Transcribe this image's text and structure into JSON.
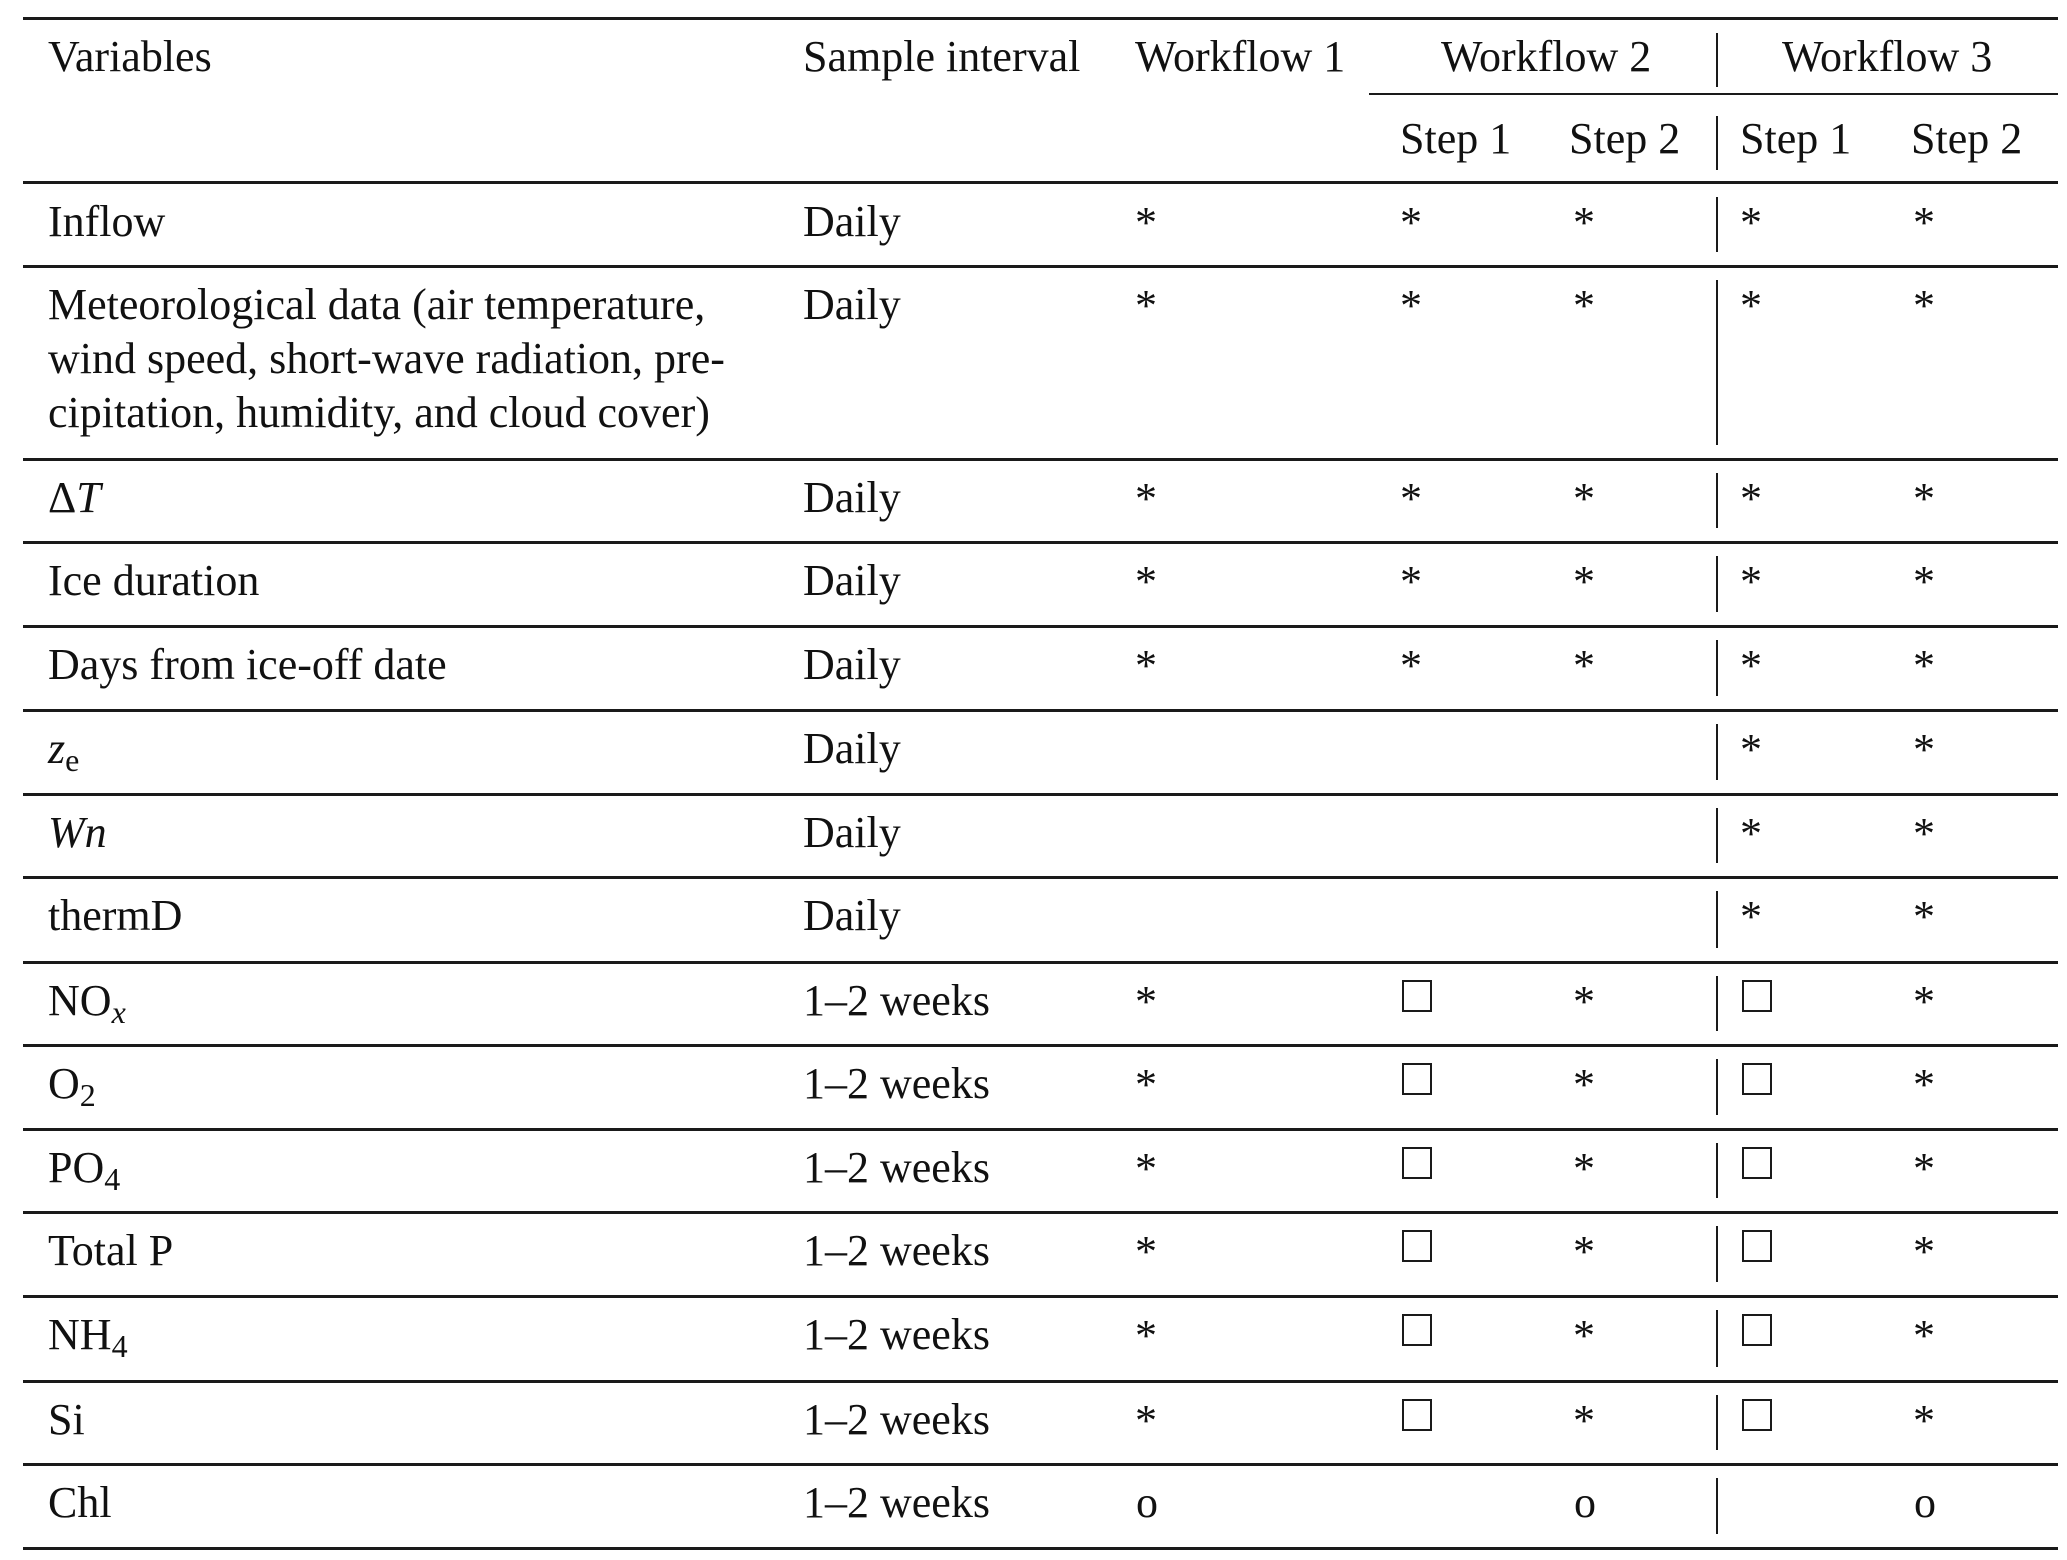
{
  "header": {
    "variables": "Variables",
    "sample_interval": "Sample interval",
    "workflow1": "Workflow 1",
    "workflow2": "Workflow 2",
    "workflow3": "Workflow 3",
    "wf2_step1": "Step 1",
    "wf2_step2": "Step 2",
    "wf3_step1": "Step 1",
    "wf3_step2": "Step 2"
  },
  "legend_symbols": {
    "star": "*",
    "box": "□",
    "circle": "o"
  },
  "rows": [
    {
      "variable": "Inflow",
      "interval": "Daily",
      "wf1": "*",
      "wf2_s1": "*",
      "wf2_s2": "*",
      "wf3_s1": "*",
      "wf3_s2": "*"
    },
    {
      "variable": "Meteorological data (air temperature, wind speed, short-wave radiation, pre-cipitation, humidity, and cloud cover)",
      "line1": "Meteorological data (air temperature,",
      "line2": "wind speed, short-wave radiation, pre-",
      "line3": "cipitation, humidity, and cloud cover)",
      "interval": "Daily",
      "wf1": "*",
      "wf2_s1": "*",
      "wf2_s2": "*",
      "wf3_s1": "*",
      "wf3_s2": "*"
    },
    {
      "variable": "ΔT",
      "var_main": "Δ",
      "var_italic": "T",
      "interval": "Daily",
      "wf1": "*",
      "wf2_s1": "*",
      "wf2_s2": "*",
      "wf3_s1": "*",
      "wf3_s2": "*"
    },
    {
      "variable": "Ice duration",
      "interval": "Daily",
      "wf1": "*",
      "wf2_s1": "*",
      "wf2_s2": "*",
      "wf3_s1": "*",
      "wf3_s2": "*"
    },
    {
      "variable": "Days from ice-off date",
      "interval": "Daily",
      "wf1": "*",
      "wf2_s1": "*",
      "wf2_s2": "*",
      "wf3_s1": "*",
      "wf3_s2": "*"
    },
    {
      "variable": "ze",
      "var_main": "z",
      "var_sub": "e",
      "interval": "Daily",
      "wf1": "",
      "wf2_s1": "",
      "wf2_s2": "",
      "wf3_s1": "*",
      "wf3_s2": "*"
    },
    {
      "variable": "Wn",
      "interval": "Daily",
      "wf1": "",
      "wf2_s1": "",
      "wf2_s2": "",
      "wf3_s1": "*",
      "wf3_s2": "*"
    },
    {
      "variable": "thermD",
      "interval": "Daily",
      "wf1": "",
      "wf2_s1": "",
      "wf2_s2": "",
      "wf3_s1": "*",
      "wf3_s2": "*"
    },
    {
      "variable": "NOx",
      "var_main": "NO",
      "var_sub": "x",
      "interval": "1–2 weeks",
      "wf1": "*",
      "wf2_s1": "□",
      "wf2_s2": "*",
      "wf3_s1": "□",
      "wf3_s2": "*"
    },
    {
      "variable": "O2",
      "var_main": "O",
      "var_sub": "2",
      "interval": "1–2 weeks",
      "wf1": "*",
      "wf2_s1": "□",
      "wf2_s2": "*",
      "wf3_s1": "□",
      "wf3_s2": "*"
    },
    {
      "variable": "PO4",
      "var_main": "PO",
      "var_sub": "4",
      "interval": "1–2 weeks",
      "wf1": "*",
      "wf2_s1": "□",
      "wf2_s2": "*",
      "wf3_s1": "□",
      "wf3_s2": "*"
    },
    {
      "variable": "Total P",
      "interval": "1–2 weeks",
      "wf1": "*",
      "wf2_s1": "□",
      "wf2_s2": "*",
      "wf3_s1": "□",
      "wf3_s2": "*"
    },
    {
      "variable": "NH4",
      "var_main": "NH",
      "var_sub": "4",
      "interval": "1–2 weeks",
      "wf1": "*",
      "wf2_s1": "□",
      "wf2_s2": "*",
      "wf3_s1": "□",
      "wf3_s2": "*"
    },
    {
      "variable": "Si",
      "interval": "1–2 weeks",
      "wf1": "*",
      "wf2_s1": "□",
      "wf2_s2": "*",
      "wf3_s1": "□",
      "wf3_s2": "*"
    },
    {
      "variable": "Chl",
      "interval": "1–2 weeks",
      "wf1": "o",
      "wf2_s1": "",
      "wf2_s2": "o",
      "wf3_s1": "",
      "wf3_s2": "o"
    }
  ]
}
